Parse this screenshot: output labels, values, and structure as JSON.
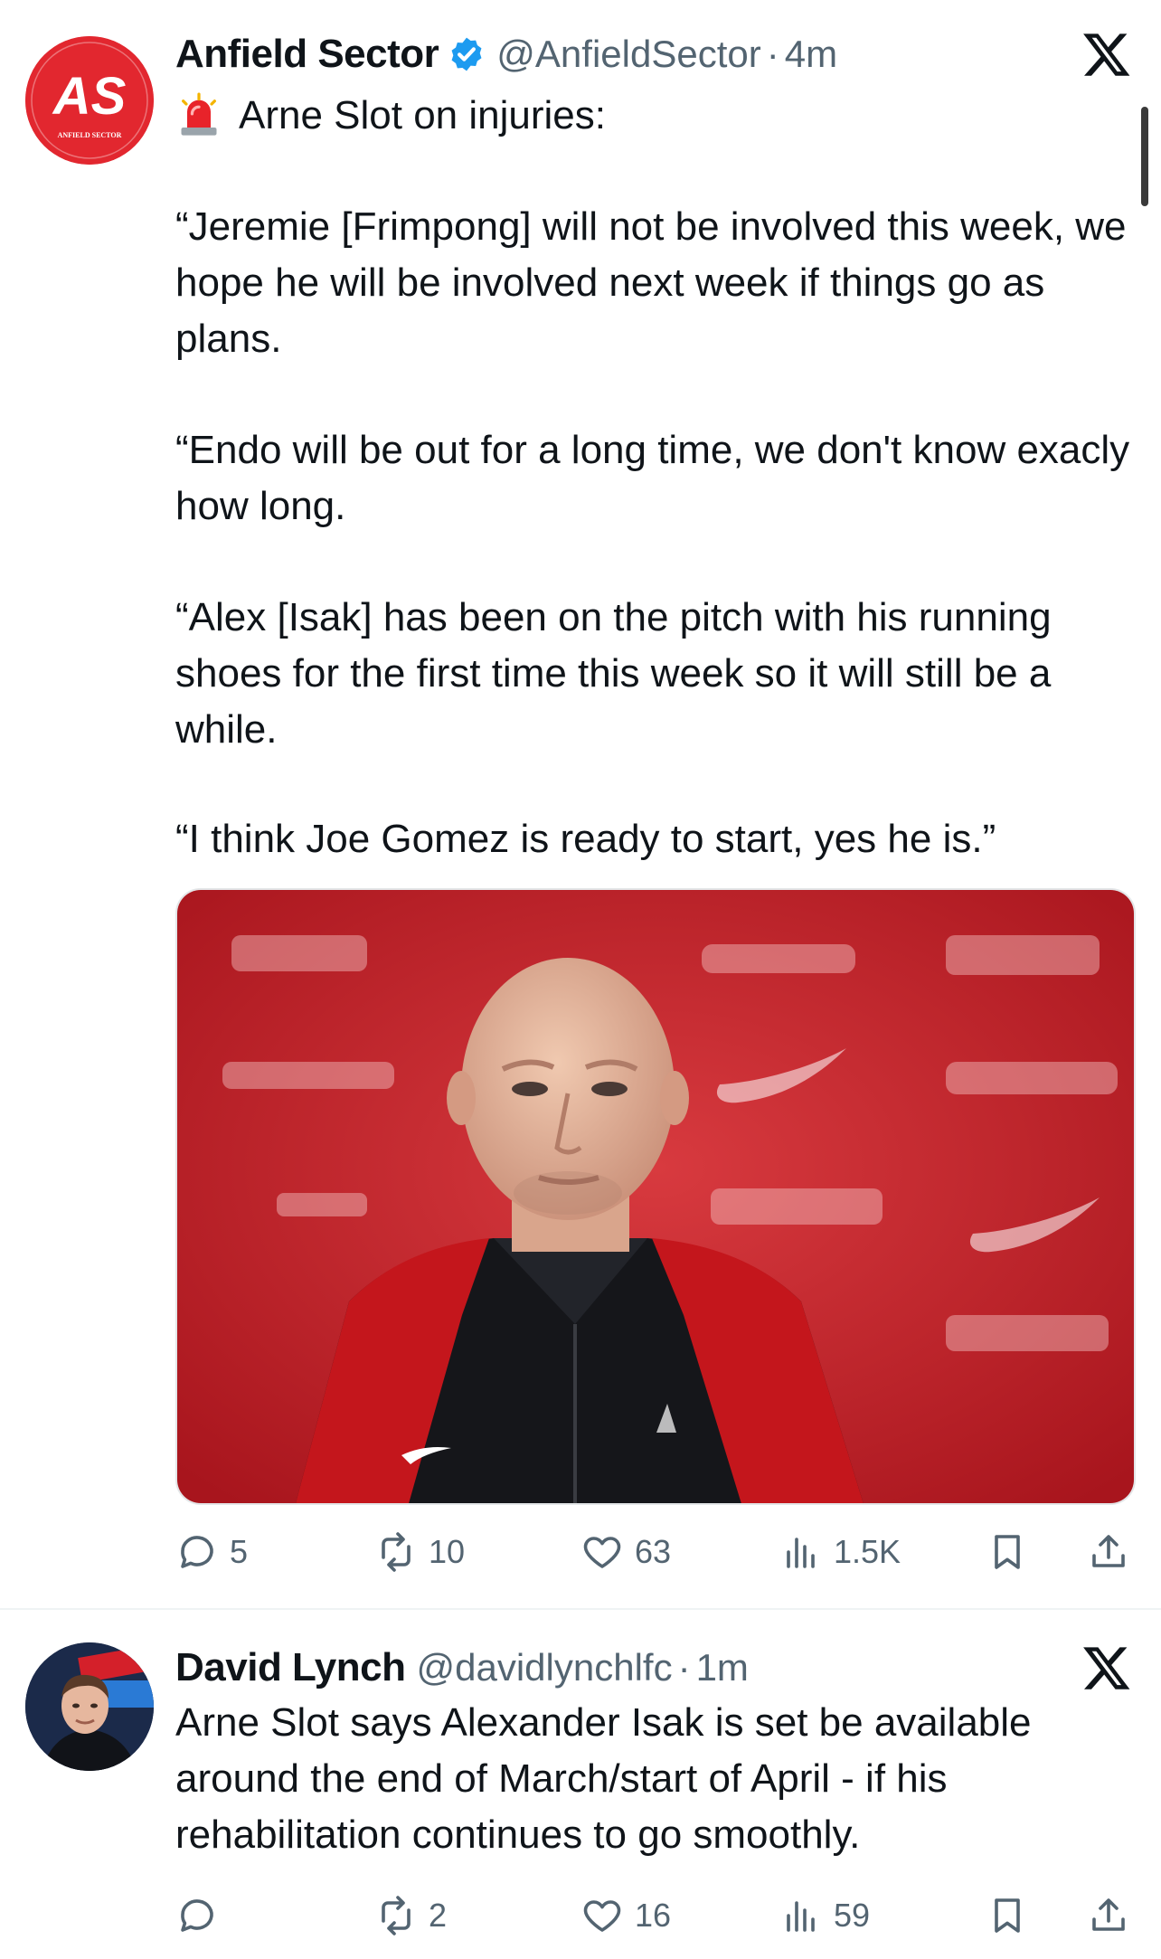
{
  "tweets": [
    {
      "author": {
        "display_name": "Anfield Sector",
        "handle": "@AnfieldSector",
        "verified": true,
        "avatar_text": "AS",
        "avatar_subtext": "ANFIELD SECTOR"
      },
      "time": "4m",
      "separator": "·",
      "first_line_icon": "police-light-icon",
      "first_line": "Arne Slot on injuries:",
      "paragraphs": [
        "“Jeremie [Frimpong] will not be involved this week, we hope he will be involved next week if things go as plans.",
        "“Endo will be out for a long time, we don't know exacly how long.",
        "“Alex [Isak] has been on the pitch with his running shoes for the first time this week so it will still be a while.",
        "“I think Joe Gomez is ready to start, yes he is.”"
      ],
      "media": {
        "kind": "photo"
      },
      "actions": {
        "replies": "5",
        "reposts": "10",
        "likes": "63",
        "views": "1.5K"
      }
    },
    {
      "author": {
        "display_name": "David Lynch",
        "handle": "@davidlynchlfc",
        "verified": false
      },
      "time": "1m",
      "separator": "·",
      "text": "Arne Slot says Alexander Isak is set be available around the end of March/start of April - if his rehabilitation continues to go smoothly.",
      "actions": {
        "replies": "",
        "reposts": "2",
        "likes": "16",
        "views": "59"
      }
    }
  ],
  "colors": {
    "text": "#0f1419",
    "secondary": "#536471",
    "verified": "#1d9bf0",
    "avatar_red": "#e2272f"
  }
}
